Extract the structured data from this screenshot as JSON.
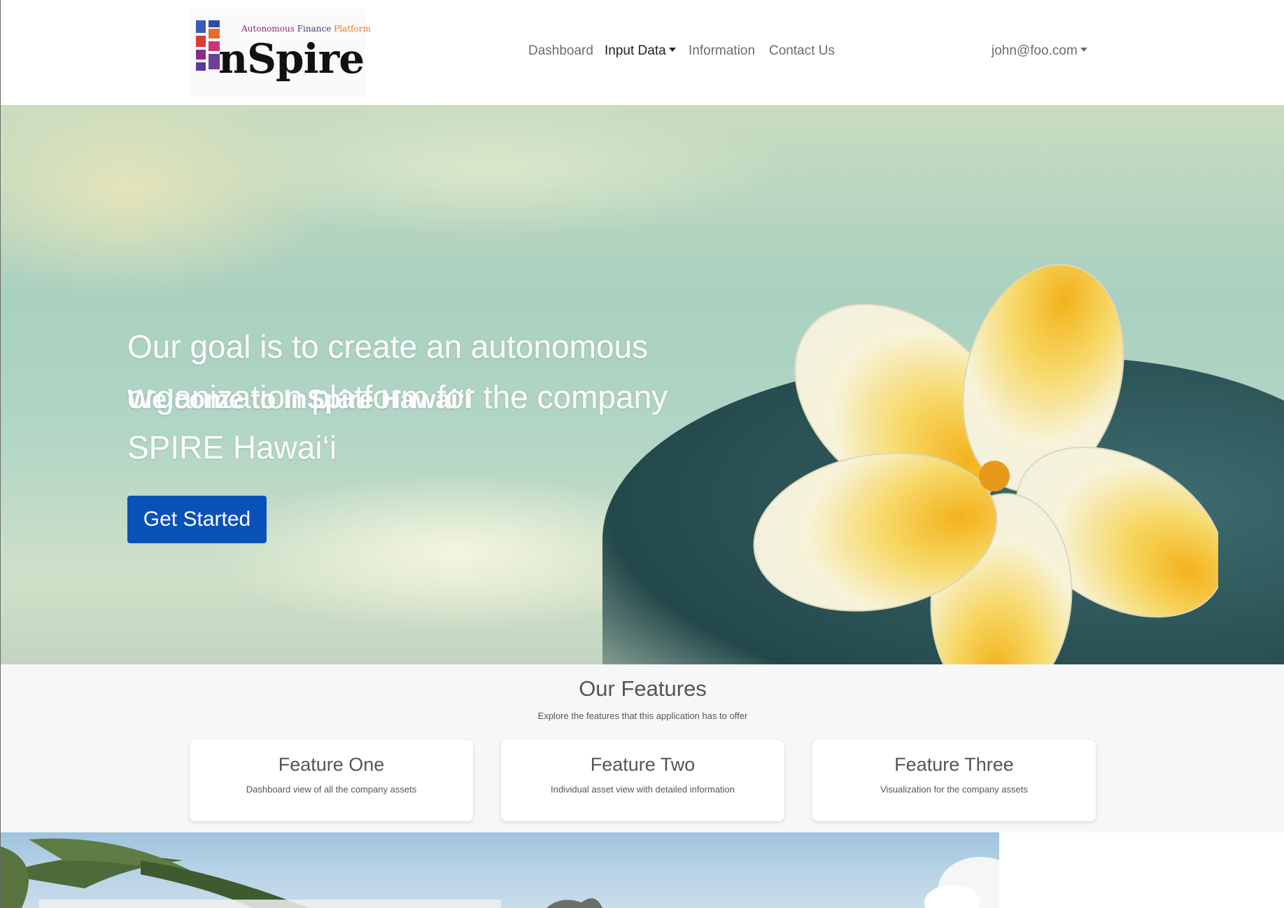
{
  "logo": {
    "tagline_part1": "Autonomous",
    "tagline_part2": "Finance",
    "tagline_part3": "Platform",
    "wordmark": "nSpire"
  },
  "nav": {
    "dashboard": "Dashboard",
    "input_data": "Input Data",
    "information": "Information",
    "contact_us": "Contact Us",
    "user": "john@foo.com"
  },
  "hero": {
    "title": "Welcome to InSpire Hawai‘i",
    "line1": "Our goal is to create an autonomous",
    "line2": "organization platform for the company",
    "line3": "SPIRE Hawai‘i",
    "cta": "Get Started"
  },
  "features": {
    "title": "Our Features",
    "subtitle": "Explore the features that this application has to offer",
    "cards": [
      {
        "title": "Feature One",
        "description": "Dashboard view of all the company assets"
      },
      {
        "title": "Feature Two",
        "description": "Individual asset view with detailed information"
      },
      {
        "title": "Feature Three",
        "description": "Visualization for the company assets"
      }
    ]
  },
  "colors": {
    "primary_button": "#0b52b8",
    "nav_text": "#6c6c6c",
    "nav_active": "#222222",
    "features_bg": "#f7f7f7"
  }
}
